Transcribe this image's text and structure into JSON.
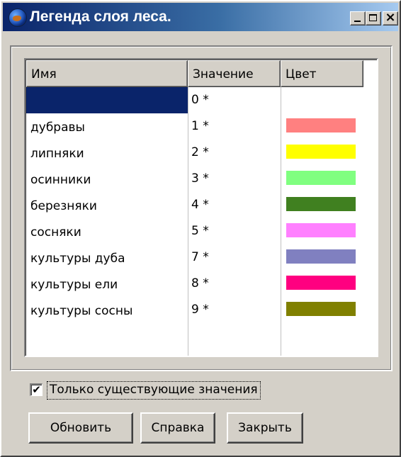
{
  "window": {
    "title": "Легенда слоя леса.",
    "close_glyph": "×"
  },
  "table": {
    "columns": [
      "Имя",
      "Значение",
      "Цвет"
    ],
    "rows": [
      {
        "name": "",
        "value": "0 *",
        "color": null
      },
      {
        "name": "дубравы",
        "value": "1 *",
        "color": "#ff8080"
      },
      {
        "name": "липняки",
        "value": "2 *",
        "color": "#ffff00"
      },
      {
        "name": "осинники",
        "value": "3 *",
        "color": "#80ff80"
      },
      {
        "name": "березняки",
        "value": "4 *",
        "color": "#408020"
      },
      {
        "name": "сосняки",
        "value": "5 *",
        "color": "#ff80ff"
      },
      {
        "name": "культуры дуба",
        "value": "7 *",
        "color": "#8080c0"
      },
      {
        "name": "культуры ели",
        "value": "8 *",
        "color": "#ff0080"
      },
      {
        "name": "культуры сосны",
        "value": "9 *",
        "color": "#808000"
      }
    ]
  },
  "controls": {
    "checkbox_checked": true,
    "checkbox_mark": "✔",
    "checkbox_label": "Только  существующие значения",
    "refresh_label": "Обновить",
    "help_label": "Справка",
    "close_label": "Закрыть"
  },
  "colors": {
    "selection": "#0a246a",
    "face": "#d4d0c8"
  }
}
